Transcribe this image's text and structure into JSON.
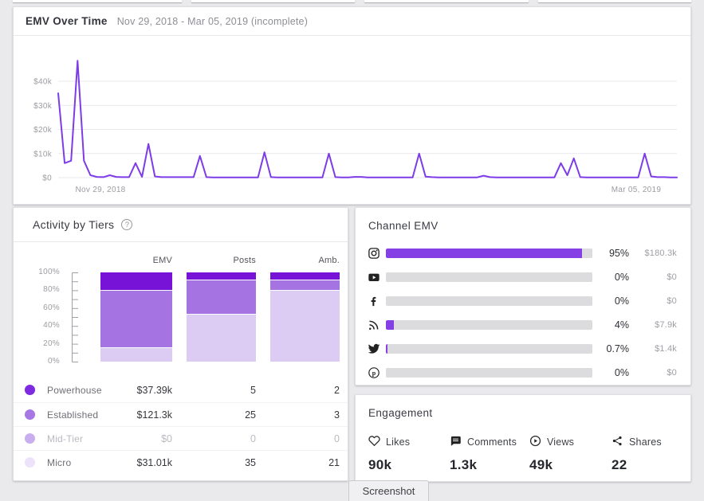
{
  "page": {
    "background": "#eaeaec"
  },
  "emv_over_time": {
    "title": "EMV Over Time",
    "subtitle": "Nov 29, 2018 - Mar 05, 2019 (incomplete)",
    "y_axis": [
      {
        "value": 40,
        "label": "$40k"
      },
      {
        "value": 30,
        "label": "$30k"
      },
      {
        "value": 20,
        "label": "$20k"
      },
      {
        "value": 10,
        "label": "$10k"
      },
      {
        "value": 0,
        "label": "$0"
      }
    ],
    "x_start_label": "Nov 29, 2018",
    "x_end_label": "Mar 05, 2019",
    "line_color": "#7d3ce8",
    "grid_color": "#e9e9ed"
  },
  "activity_by_tiers": {
    "title": "Activity by Tiers",
    "help_icon": "question-circle",
    "columns": [
      "EMV",
      "Posts",
      "Amb."
    ],
    "y_ticks": [
      "100%",
      "80%",
      "60%",
      "40%",
      "20%",
      "0%"
    ],
    "tiers": [
      {
        "name": "Powerhouse",
        "color": "#7712d7",
        "dot_color": "#7d2ae0",
        "emv": "$37.39k",
        "posts": "5",
        "amb": "2",
        "muted": false
      },
      {
        "name": "Established",
        "color": "#a673e2",
        "dot_color": "#a778e3",
        "emv": "$121.3k",
        "posts": "25",
        "amb": "3",
        "muted": false
      },
      {
        "name": "Mid-Tier",
        "color": "#c6a9ee",
        "dot_color": "#c9aeef",
        "emv": "$0",
        "posts": "0",
        "amb": "0",
        "muted": true
      },
      {
        "name": "Micro",
        "color": "#dccbf3",
        "dot_color": "#ece3fa",
        "emv": "$31.01k",
        "posts": "35",
        "amb": "21",
        "muted": false
      }
    ]
  },
  "channel_emv": {
    "title": "Channel EMV",
    "bar_color": "#8440e4",
    "track_color": "#dcdcdf",
    "channels": [
      {
        "icon": "instagram-icon",
        "name": "Instagram",
        "percent": "95%",
        "value": "$180.3k"
      },
      {
        "icon": "youtube-icon",
        "name": "YouTube",
        "percent": "0%",
        "value": "$0"
      },
      {
        "icon": "facebook-icon",
        "name": "Facebook",
        "percent": "0%",
        "value": "$0"
      },
      {
        "icon": "blog-rss-icon",
        "name": "Blog",
        "percent": "4%",
        "value": "$7.9k"
      },
      {
        "icon": "twitter-icon",
        "name": "Twitter",
        "percent": "0.7%",
        "value": "$1.4k"
      },
      {
        "icon": "pinterest-icon",
        "name": "Pinterest",
        "percent": "0%",
        "value": "$0"
      }
    ]
  },
  "engagement": {
    "title": "Engagement",
    "stats": [
      {
        "icon": "heart-icon",
        "label": "Likes",
        "value": "90k"
      },
      {
        "icon": "comment-icon",
        "label": "Comments",
        "value": "1.3k"
      },
      {
        "icon": "play-circle-icon",
        "label": "Views",
        "value": "49k"
      },
      {
        "icon": "share-icon",
        "label": "Shares",
        "value": "22"
      }
    ]
  },
  "screenshot_bubble": {
    "label": "Screenshot"
  },
  "chart_data": [
    {
      "type": "line",
      "title": "EMV Over Time",
      "x_range": [
        "Nov 29, 2018",
        "Mar 05, 2019"
      ],
      "x_unit": "day",
      "y_unit": "USD thousands",
      "ylim": [
        0,
        50
      ],
      "y_ticks": [
        0,
        10,
        20,
        30,
        40
      ],
      "grid": true,
      "values_k": [
        35,
        6,
        7,
        48.5,
        7,
        1,
        0.3,
        0.2,
        1,
        0.3,
        0.2,
        0.2,
        6,
        0.3,
        14,
        0.5,
        0.2,
        0.2,
        0.2,
        0.2,
        0.2,
        0.2,
        9,
        0.2,
        0.1,
        0.1,
        0.1,
        0.1,
        0.1,
        0.1,
        0.1,
        0.1,
        10.5,
        0.2,
        0.1,
        0.1,
        0.1,
        0.1,
        0.1,
        0.1,
        0.1,
        0.1,
        10,
        0.2,
        0.1,
        0.1,
        0.3,
        0.3,
        0.1,
        0.1,
        0.1,
        0.1,
        0.1,
        0.1,
        0.1,
        0.1,
        10,
        0.4,
        0.2,
        0.1,
        0.1,
        0.1,
        0.1,
        0.1,
        0.1,
        0.1,
        0.8,
        0.2,
        0.1,
        0.1,
        0.1,
        0.1,
        0.1,
        0.1,
        0.1,
        0.1,
        0.1,
        0.1,
        6,
        1,
        8,
        0.2,
        0.1,
        0.1,
        0.1,
        0.1,
        0.1,
        0.1,
        0.1,
        0.1,
        0.1,
        10,
        0.5,
        0.2,
        0.2,
        0.1,
        0.1
      ]
    },
    {
      "type": "bar",
      "subtype": "stacked-percent",
      "title": "Activity by Tiers",
      "categories": [
        "EMV",
        "Posts",
        "Amb."
      ],
      "series": [
        {
          "name": "Powerhouse",
          "values": [
            37.39,
            5,
            2
          ]
        },
        {
          "name": "Established",
          "values": [
            121.3,
            25,
            3
          ]
        },
        {
          "name": "Mid-Tier",
          "values": [
            0,
            0,
            0
          ]
        },
        {
          "name": "Micro",
          "values": [
            31.01,
            35,
            21
          ]
        }
      ],
      "ylim": [
        0,
        100
      ],
      "legend_position": "bottom"
    },
    {
      "type": "bar",
      "subtype": "horizontal",
      "title": "Channel EMV",
      "categories": [
        "Instagram",
        "YouTube",
        "Facebook",
        "Blog",
        "Twitter",
        "Pinterest"
      ],
      "values_percent": [
        95,
        0,
        0,
        4,
        0.7,
        0
      ],
      "values_emv": [
        "$180.3k",
        "$0",
        "$0",
        "$7.9k",
        "$1.4k",
        "$0"
      ],
      "xlim": [
        0,
        100
      ]
    }
  ]
}
